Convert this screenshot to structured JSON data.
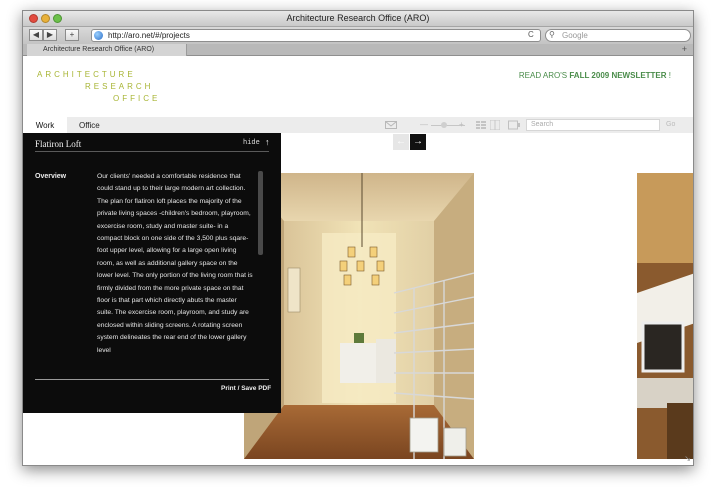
{
  "window": {
    "title": "Architecture Research Office (ARO)"
  },
  "browser": {
    "url": "http://aro.net/#/projects",
    "search_placeholder": "Google",
    "tab_label": "Architecture Research Office (ARO)",
    "back_glyph": "◀",
    "forward_glyph": "▶",
    "add_glyph": "+",
    "reload_glyph": "C",
    "tab_add_glyph": "+"
  },
  "site": {
    "logo_lines": [
      "ARCHITECTURE",
      "RESEARCH",
      "OFFICE"
    ],
    "newsletter": {
      "prefix": "READ ARO'S ",
      "highlight": "FALL 2009 NEWSLETTER",
      "suffix": " !"
    },
    "nav": {
      "work": "Work",
      "office": "Office"
    },
    "search_placeholder": "Search",
    "go_label": "Go",
    "zoom_minus": "—",
    "zoom_plus": "+"
  },
  "gallery": {
    "prev_glyph": "←",
    "next_glyph": "→"
  },
  "panel": {
    "title": "Flatiron Loft",
    "hide_label": "hide",
    "hide_glyph": "↑",
    "section_label": "Overview",
    "body": "Our clients' needed a comfortable residence that could stand up to their large modern art collection. The plan for flatiron loft places the majority of the private living spaces -children's bedroom, playroom, excercise room, study and master suite- in a compact block on one side of the 3,500 plus sqare-foot upper level, allowing for a large open living room, as well as additional gallery space on the lower level. The only portion of the living room that is firmly divided from the more private space on that floor is that part which directly abuts the master suite. The excercise room, playroom, and study are enclosed within sliding screens. A rotating screen system delineates the rear end of the lower gallery level",
    "print_label": "Print / Save PDF"
  },
  "colors": {
    "logo": "#a8b535",
    "newsletter": "#4a8c4a",
    "panel_bg": "#0c0c0c"
  }
}
